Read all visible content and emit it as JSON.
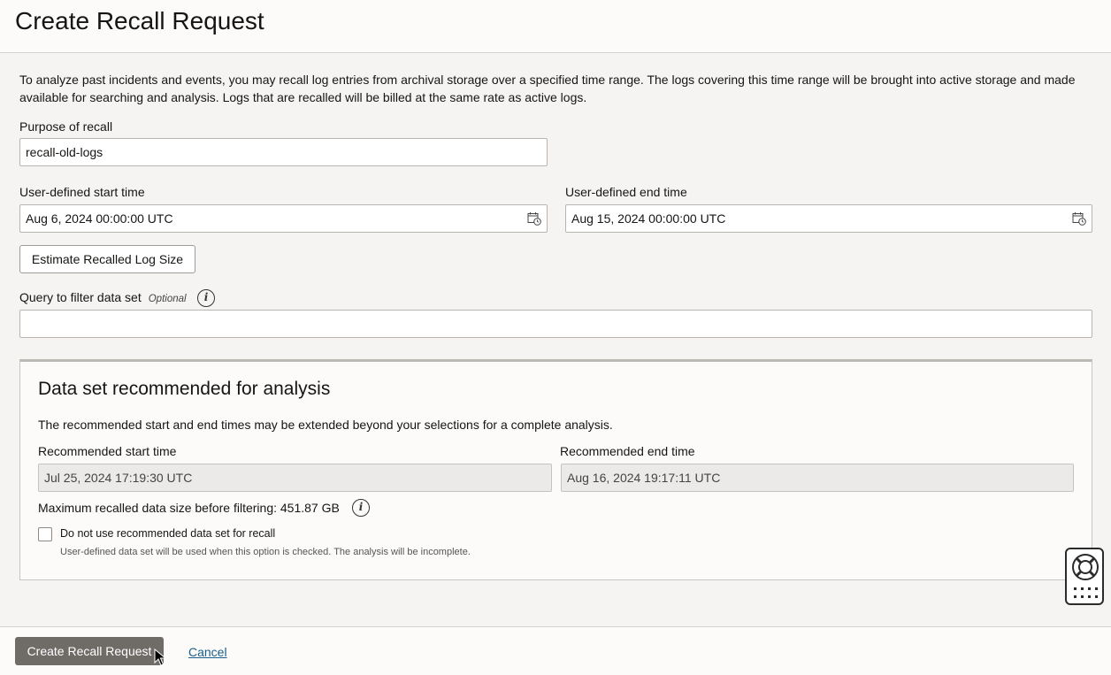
{
  "header": {
    "title": "Create Recall Request"
  },
  "main": {
    "description": "To analyze past incidents and events, you may recall log entries from archival storage over a specified time range. The logs covering this time range will be brought into active storage and made available for searching and analysis. Logs that are recalled will be billed at the same rate as active logs.",
    "purpose": {
      "label": "Purpose of recall",
      "value": "recall-old-logs"
    },
    "start_time": {
      "label": "User-defined start time",
      "value": "Aug 6, 2024 00:00:00 UTC",
      "icon": "calendar-clock-icon"
    },
    "end_time": {
      "label": "User-defined end time",
      "value": "Aug 15, 2024 00:00:00 UTC",
      "icon": "calendar-clock-icon"
    },
    "estimate_button": "Estimate Recalled Log Size",
    "query": {
      "label": "Query to filter data set",
      "optional": "Optional",
      "value": "",
      "icon": "info-icon"
    }
  },
  "panel": {
    "title": "Data set recommended for analysis",
    "description": "The recommended start and end times may be extended beyond your selections for a complete analysis.",
    "rec_start": {
      "label": "Recommended start time",
      "value": "Jul 25, 2024 17:19:30 UTC"
    },
    "rec_end": {
      "label": "Recommended end time",
      "value": "Aug 16, 2024 19:17:11 UTC"
    },
    "max_size": "Maximum recalled data size before filtering: 451.87 GB",
    "checkbox": {
      "label": "Do not use recommended data set for recall",
      "help": "User-defined data set will be used when this option is checked. The analysis will be incomplete.",
      "checked": false
    }
  },
  "footer": {
    "primary_button": "Create Recall Request",
    "cancel_link": "Cancel"
  },
  "widget": {
    "icon": "lifebuoy-icon",
    "menu_icon": "grid-icon"
  }
}
